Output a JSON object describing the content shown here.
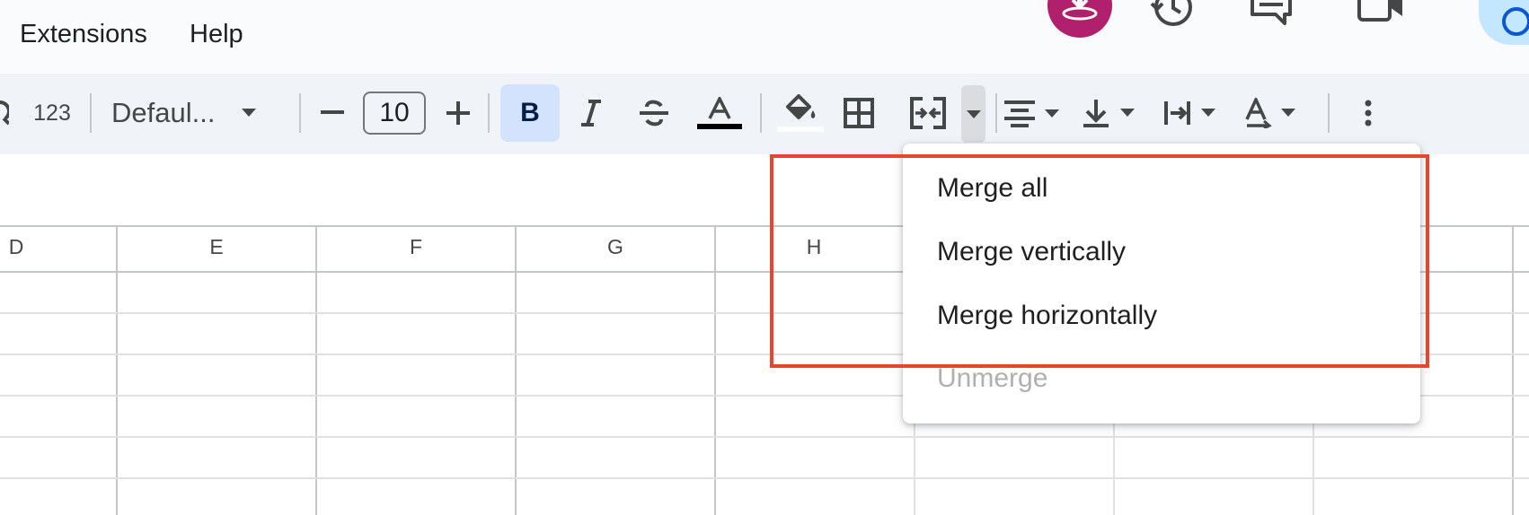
{
  "menubar": {
    "items": [
      {
        "label": "Extensions"
      },
      {
        "label": "Help"
      }
    ]
  },
  "toolbar": {
    "number_format_label": "123",
    "font_name": "Defaul...",
    "font_size": "10",
    "bold_label": "B",
    "text_color": "#000000",
    "fill_color": "#ffffff"
  },
  "columns": [
    "D",
    "E",
    "F",
    "G",
    "H"
  ],
  "merge_menu": {
    "items": [
      {
        "label": "Merge all",
        "enabled": true
      },
      {
        "label": "Merge vertically",
        "enabled": true
      },
      {
        "label": "Merge horizontally",
        "enabled": true
      },
      {
        "label": "Unmerge",
        "enabled": false
      }
    ]
  },
  "colors": {
    "highlight": "#e8452c",
    "bold_active_bg": "#d3e3fd",
    "avatar": "#b0206c",
    "share_button": "#c2e7ff"
  }
}
